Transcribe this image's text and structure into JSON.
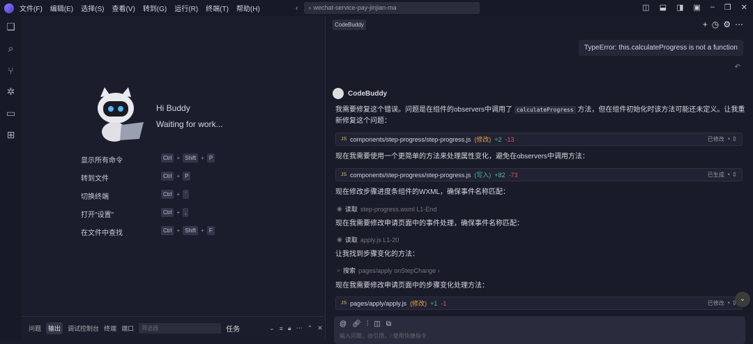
{
  "menu": [
    "文件(F)",
    "编辑(E)",
    "选择(S)",
    "查看(V)",
    "转到(G)",
    "运行(R)",
    "终端(T)",
    "帮助(H)"
  ],
  "search": "wechat-service-pay-jinjian-ma",
  "welcome": {
    "greeting": "Hi Buddy",
    "status": "Waiting for work...",
    "shortcuts": [
      {
        "label": "显示所有命令",
        "keys": [
          "Ctrl",
          "Shift",
          "P"
        ]
      },
      {
        "label": "转到文件",
        "keys": [
          "Ctrl",
          "P"
        ]
      },
      {
        "label": "切换终端",
        "keys": [
          "Ctrl",
          "`"
        ]
      },
      {
        "label": "打开\"设置\"",
        "keys": [
          "Ctrl",
          ","
        ]
      },
      {
        "label": "在文件中查找",
        "keys": [
          "Ctrl",
          "Shift",
          "F"
        ]
      }
    ]
  },
  "panel": {
    "tabs": [
      "问题",
      "输出",
      "调试控制台",
      "终端",
      "端口"
    ],
    "filter_placeholder": "筛选器",
    "task": "任务"
  },
  "chat": {
    "tag": "CodeBuddy",
    "user_msg": "TypeError: this.calculateProgress is not a function",
    "assistant": "CodeBuddy",
    "m1a": "我需要修复这个错误。问题是在组件的observers中调用了",
    "m1code": "calculateProgress",
    "m1b": "方法，但在组件初始化时该方法可能还未定义。让我重新修复这个问题：",
    "f1": {
      "path": "components/step-progress/step-progress.js",
      "badge": "(修改)",
      "add": "+2",
      "del": "-13",
      "status": "已修改"
    },
    "m2": "现在我需要使用一个更简单的方法来处理属性变化，避免在observers中调用方法：",
    "f2": {
      "path": "components/step-progress/step-progress.js",
      "badge": "(写入)",
      "add": "+82",
      "del": "-73",
      "status": "已生成"
    },
    "m3": "现在修改步骤进度条组件的WXML，确保事件名称匹配：",
    "t1": {
      "verb": "读取",
      "target": "step-progress.wxml L1-End"
    },
    "m4": "现在我需要修改申请页面中的事件处理，确保事件名称匹配：",
    "t2": {
      "verb": "读取",
      "target": "apply.js L1-20"
    },
    "m5": "让我找到步骤变化的方法：",
    "t3": {
      "verb": "搜索",
      "target": "pages/apply onStepChange ›"
    },
    "m6": "现在我需要修改申请页面中的步骤变化处理方法：",
    "f3": {
      "path": "pages/apply/apply.js",
      "badge": "(修改)",
      "add": "+1",
      "del": "-1",
      "status": "已修改"
    },
    "placeholder": "输入问题，@引用，/ 使用快捷指令"
  }
}
